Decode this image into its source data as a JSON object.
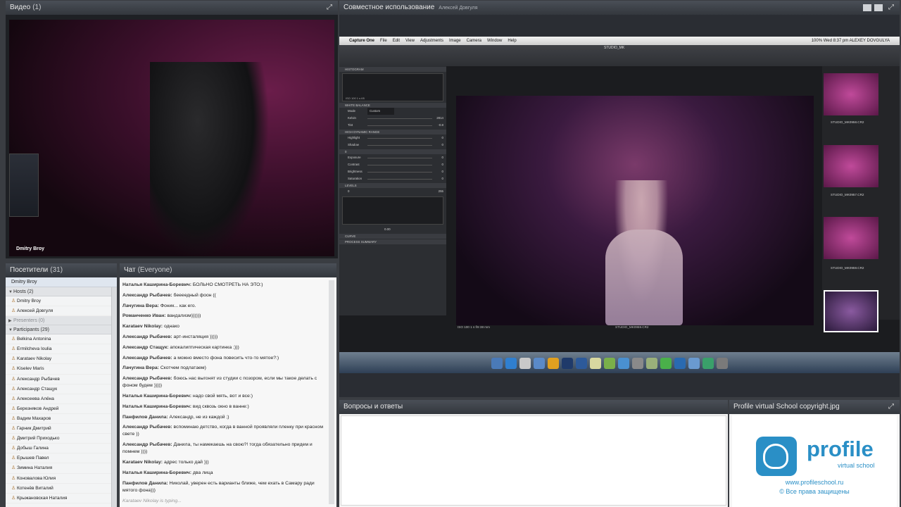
{
  "video": {
    "title": "Видео",
    "count": "(1)",
    "presenter": "Dmitry Broy"
  },
  "attendees": {
    "title": "Посетители",
    "count": "(31)",
    "selected": "Dmitry Broy",
    "hosts_label": "Hosts (2)",
    "presenters_label": "Presenters (0)",
    "participants_label": "Participants (29)",
    "hosts": [
      "Dmitry Broy",
      "Алексей Довгуля"
    ],
    "participants": [
      "Belkina Antonina",
      "Ermilcheva Ioulia",
      "Karataev Nikolay",
      "Kiselev Maris",
      "Александр Рыбачев",
      "Александр Стащук",
      "Алексеева Алёна",
      "Березняков Андрей",
      "Вадим Махаров",
      "Гарник Дмитрий",
      "Дмитрий Приходько",
      "Добыш Галина",
      "Ерышев Павел",
      "Зимина Наталия",
      "Коновалова Юлия",
      "Котенёв Виталий",
      "Крыжановская Наталия"
    ]
  },
  "chat": {
    "title": "Чат",
    "audience": "(Everyone)",
    "typing": "Karataev Nikolay is typing...",
    "messages": [
      {
        "from": "Наталья Каширина-Боревич:",
        "text": "БОЛЬНО СМОТРЕТЬ НА ЭТО:)"
      },
      {
        "from": "Александр Рыбачев:",
        "text": "беееедный фоон (("
      },
      {
        "from": "Лачугина Вера:",
        "text": "Фоник... как его."
      },
      {
        "from": "Романченко Иван:",
        "text": "вандализм))))))"
      },
      {
        "from": "Karataev Nikolay:",
        "text": "однако"
      },
      {
        "from": "Александр Рыбачев:",
        "text": "арт-инсталяция )))))"
      },
      {
        "from": "Александр Стащук:",
        "text": "апокалиптическая картинка ;)))"
      },
      {
        "from": "Александр Рыбачев:",
        "text": "а можно вместо фона повесить что-то мятое?:)"
      },
      {
        "from": "Лачугина Вера:",
        "text": "Скотчем подлатаем)"
      },
      {
        "from": "Александр Рыбачев:",
        "text": "боюсь нас выгонят из студии с позором, если мы такое делать с фоном будем )))))"
      },
      {
        "from": "Наталья Каширина-Боревич:",
        "text": "надо свой мять, вот и все:)"
      },
      {
        "from": "Наталья Каширина-Боревич:",
        "text": "вид сквозь окно в ванне:)"
      },
      {
        "from": "Панфилов Данила:",
        "text": "Александр, не из каждой ;)"
      },
      {
        "from": "Александр Рыбачев:",
        "text": "вспоминаю детство, когда в ванной проявляли пленку при красном свете ))"
      },
      {
        "from": "Александр Рыбачев:",
        "text": "Данила, ты намекаешь на свою?! тогда обязательно придем и помнем ))))"
      },
      {
        "from": "Karataev Nikolay:",
        "text": "адрес только дай )))"
      },
      {
        "from": "Наталья Каширина-Боревич:",
        "text": "два лица"
      },
      {
        "from": "Панфилов Данила:",
        "text": "Николай, уверен есть варианты ближе, чем ехать в Самару ради мятого фона)))"
      }
    ]
  },
  "share": {
    "title": "Совместное использование",
    "presenter": "Алексей Довгуля",
    "mac_menu": [
      "Capture One",
      "File",
      "Edit",
      "View",
      "Adjustments",
      "Image",
      "Camera",
      "Window",
      "Help"
    ],
    "mac_status": "100%  Wed 8:37 pm  ALEXEY DOVGULYA",
    "session": "STUDIO_MK",
    "panels": {
      "histogram": "HISTOGRAM",
      "white_balance": "WHITE BALANCE",
      "hdr": "HIGH DYNAMIC RANGE",
      "exposure": "0",
      "levels": "LEVELS",
      "curve": "CURVE",
      "process": "PROCESS SUMMARY",
      "wb_mode_label": "Mode",
      "wb_mode": "Custom",
      "kelvin_label": "Kelvin",
      "kelvin": "2814",
      "tint_label": "Tint",
      "tint": "-0.8",
      "highlight_label": "Highlight",
      "highlight": "0",
      "shadow_label": "Shadow",
      "shadow": "0",
      "exposure_label": "Exposure",
      "contrast_label": "Contrast",
      "contrast": "0",
      "brightness_label": "Brightness",
      "brightness": "0",
      "saturation_label": "Saturation",
      "saturation": "0",
      "hist_info": "ISO 100    1 s    f/8",
      "levels_lo": "0",
      "levels_hi": "255",
      "levels_mid": "0.00"
    },
    "image_info": "ISO 100   1 s   f/8   38 mm",
    "image_name": "STUDIO_MK0959.CR2",
    "thumbs": [
      "STUDIO_MK0958.CR2",
      "STUDIO_MK0957.CR2",
      "STUDIO_MK0959.CR2"
    ]
  },
  "qa": {
    "title": "Вопросы и ответы"
  },
  "imagepod": {
    "title": "Profile virtual School copyright.jpg",
    "brand": "profile",
    "tagline": "virtual school",
    "url": "www.profileschool.ru",
    "copyright": "© Все права защищены"
  },
  "colors": {
    "pod_header": "#3a3e45",
    "accent": "#2a8fc6",
    "magenta": "#6a1d4a"
  }
}
